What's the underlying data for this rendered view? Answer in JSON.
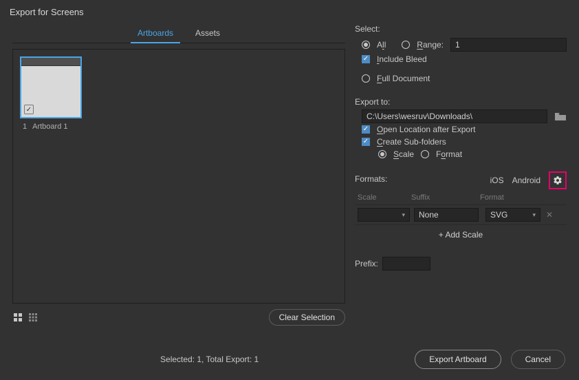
{
  "title": "Export for Screens",
  "tabs": {
    "artboards": "Artboards",
    "assets": "Assets"
  },
  "artboard": {
    "num": "1",
    "name": "Artboard 1"
  },
  "buttons": {
    "clear": "Clear Selection",
    "export": "Export Artboard",
    "cancel": "Cancel"
  },
  "select": {
    "label": "Select:",
    "all_pre": "A",
    "all_u": "l",
    "all_post": "l",
    "range_u": "R",
    "range_post": "ange:",
    "range_value": "1",
    "include_u": "I",
    "include_post": "nclude Bleed",
    "full_u": "F",
    "full_post": "ull Document"
  },
  "export": {
    "label": "Export to:",
    "path": "C:\\Users\\wesruv\\Downloads\\",
    "open_u": "O",
    "open_post": "pen Location after Export",
    "sub_u": "C",
    "sub_post": "reate Sub-folders",
    "scale_u": "S",
    "scale_post": "cale",
    "format_pre": "F",
    "format_u": "o",
    "format_post": "rmat"
  },
  "formats": {
    "label": "Formats:",
    "ios": "iOS",
    "android": "Android",
    "head_scale": "Scale",
    "head_suffix": "Suffix",
    "head_format": "Format",
    "suffix_val": "None",
    "format_val": "SVG",
    "add": "+  Add Scale"
  },
  "prefix": {
    "label": "Prefix:"
  },
  "status": "Selected: 1, Total Export: 1"
}
